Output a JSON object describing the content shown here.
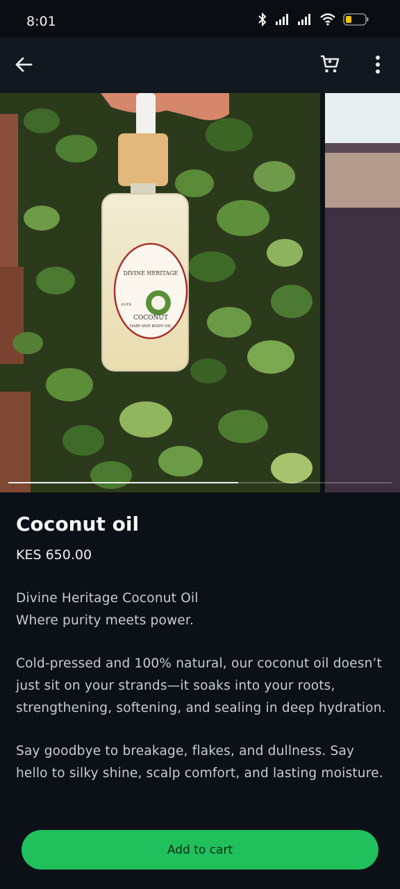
{
  "status_bar": {
    "time": "8:01",
    "icons": [
      "bluetooth-icon",
      "signal-icon",
      "signal-icon",
      "wifi-icon",
      "battery-icon"
    ],
    "battery_color": "#f2c200"
  },
  "app_bar": {
    "icons": [
      "back-arrow-icon",
      "cart-icon",
      "more-vert-icon"
    ]
  },
  "gallery": {
    "images": [
      {
        "description": "coconut oil dropper bottle among green ivy leaves"
      },
      {
        "description": "partial second product image"
      }
    ],
    "bottle_label": {
      "brand_line": "DIVINE HERITAGE",
      "product": "COCONUT",
      "subtitle": "HAIR AND BODY OIL",
      "estd": "ESTD"
    },
    "progress": 0.6
  },
  "product": {
    "title": "Coconut oil",
    "price": "KES 650.00",
    "description_lines": [
      "Divine Heritage Coconut Oil",
      "Where purity meets power."
    ],
    "paragraph1": "Cold-pressed and 100% natural, our coconut oil doesn’t just sit on your strands—it soaks into your roots, strengthening, softening, and sealing in deep hydration.",
    "paragraph2": "Say goodbye to breakage, flakes, and dullness. Say hello to silky shine, scalp comfort, and lasting moisture."
  },
  "cta": {
    "label": "Add to cart",
    "color": "#20c05c"
  }
}
